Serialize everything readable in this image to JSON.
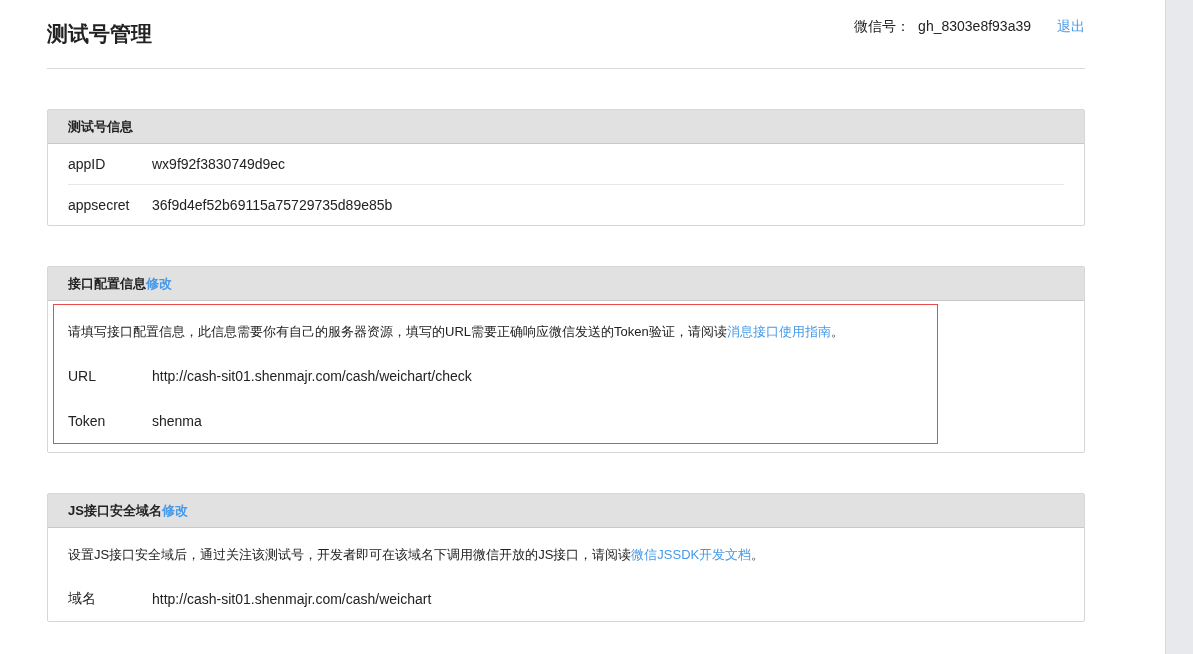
{
  "page_title": "测试号管理",
  "account": {
    "label": "微信号：",
    "value": "gh_8303e8f93a39",
    "logout": "退出"
  },
  "sections": [
    {
      "title": "测试号信息",
      "highlighted": false,
      "rows": [
        {
          "label": "appID",
          "value": "wx9f92f3830749d9ec"
        },
        {
          "label": "appsecret",
          "value": "36f9d4ef52b69115a75729735d89e85b"
        }
      ]
    },
    {
      "title": "接口配置信息",
      "edit": "修改",
      "highlighted": true,
      "description": {
        "text": "请填写接口配置信息，此信息需要你有自己的服务器资源，填写的URL需要正确响应微信发送的Token验证，请阅读",
        "link": "消息接口使用指南",
        "end": "。"
      },
      "rows": [
        {
          "label": "URL",
          "value": "http://cash-sit01.shenmajr.com/cash/weichart/check"
        },
        {
          "label": "Token",
          "value": "shenma"
        }
      ]
    },
    {
      "title": "JS接口安全域名",
      "edit": "修改",
      "highlighted": false,
      "description": {
        "text": "设置JS接口安全域后，通过关注该测试号，开发者即可在该域名下调用微信开放的JS接口，请阅读",
        "link": "微信JSSDK开发文档",
        "end": "。"
      },
      "rows": [
        {
          "label": "域名",
          "value": "http://cash-sit01.shenmajr.com/cash/weichart"
        }
      ]
    }
  ]
}
